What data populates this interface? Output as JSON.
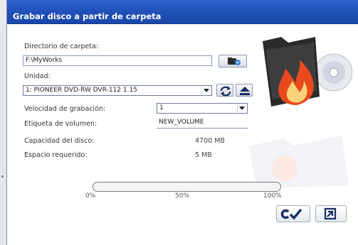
{
  "window": {
    "title": "Grabar disco a partir de carpeta"
  },
  "folder": {
    "label": "Directorio de carpeta:",
    "value": "F:\\MyWorks",
    "browse_icon": "folder-browse-icon"
  },
  "drive": {
    "label": "Unidad:",
    "value": "1: PIONEER DVD-RW  DVR-112 1.15",
    "refresh_icon": "refresh-icon",
    "eject_icon": "eject-icon"
  },
  "speed": {
    "label": "Velocidad de grabación:",
    "value": "1"
  },
  "volume": {
    "label": "Etiqueta de volumen:",
    "value": "NEW_VOLUME"
  },
  "capacity": {
    "label": "Capacidad del disco:",
    "value": "4700 MB"
  },
  "required": {
    "label": "Espacio requerido:",
    "value": "5 MB"
  },
  "progress": {
    "percent_label": "0%",
    "fraction": 0.0,
    "ticks": [
      "0%",
      "50%",
      "100%"
    ]
  },
  "actions": {
    "burn_icon": "burn-checkmark-icon",
    "exit_icon": "exit-icon"
  },
  "colors": {
    "titlebar": "#1f4fb7",
    "flame": "#e8491d",
    "folder": "#2b2b2b"
  }
}
